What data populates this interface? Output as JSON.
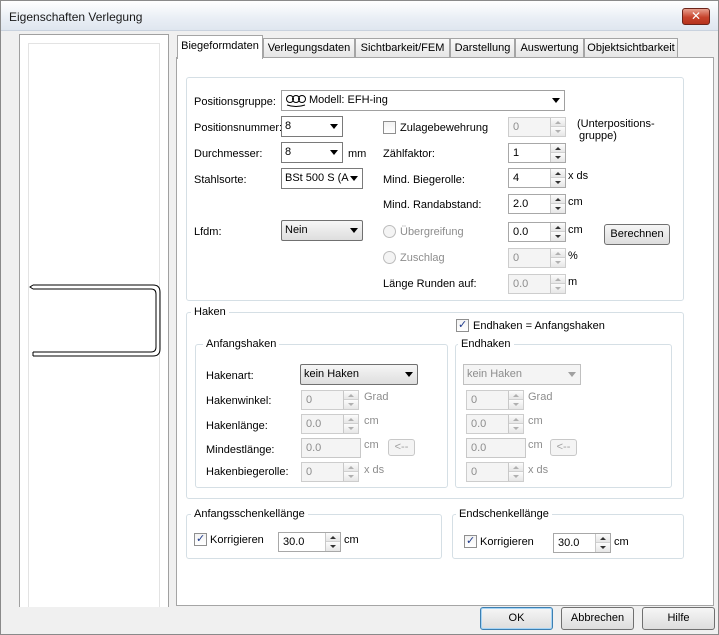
{
  "window": {
    "title": "Eigenschaften Verlegung",
    "close_glyph": "✕"
  },
  "tabs": [
    "Biegeformdaten",
    "Verlegungsdaten",
    "Sichtbarkeit/FEM",
    "Darstellung",
    "Auswertung",
    "Objektsichtbarkeit"
  ],
  "active_tab": "Biegeformdaten",
  "form": {
    "positionsgruppe_label": "Positionsgruppe:",
    "positionsgruppe_value": "Modell: EFH-ing",
    "positionsgruppe_icon": "model-group-icon",
    "positionsnummer_label": "Positionsnummer:",
    "positionsnummer_value": "8",
    "durchmesser_label": "Durchmesser:",
    "durchmesser_value": "8",
    "durchmesser_unit": "mm",
    "stahlsorte_label": "Stahlsorte:",
    "stahlsorte_value": "BSt 500 S (A",
    "lfdm_label": "Lfdm:",
    "lfdm_value": "Nein",
    "zulage_label": "Zulagebewehrung",
    "zulage_checked": false,
    "zulage_value": "0",
    "unterpos_note_line1": "(Unterpositions-",
    "unterpos_note_line2": "gruppe)",
    "zaehlfaktor_label": "Zählfaktor:",
    "zaehlfaktor_value": "1",
    "biegerolle_label": "Mind. Biegerolle:",
    "biegerolle_value": "4",
    "biegerolle_unit": "x ds",
    "randabstand_label": "Mind. Randabstand:",
    "randabstand_value": "2.0",
    "randabstand_unit": "cm",
    "uebergreifung_label": "Übergreifung",
    "uebergreifung_value": "0.0",
    "uebergreifung_unit": "cm",
    "berechnen_label": "Berechnen",
    "zuschlag_label": "Zuschlag",
    "zuschlag_value": "0",
    "zuschlag_unit": "%",
    "runden_label": "Länge Runden auf:",
    "runden_value": "0.0",
    "runden_unit": "m"
  },
  "haken": {
    "group_label": "Haken",
    "endhaken_equal_label": "Endhaken = Anfangshaken",
    "endhaken_equal_checked": true,
    "anfang": {
      "group_label": "Anfangshaken",
      "hakenart_label": "Hakenart:",
      "hakenart_value": "kein Haken",
      "hakenwinkel_label": "Hakenwinkel:",
      "hakenwinkel_value": "0",
      "hakenwinkel_unit": "Grad",
      "hakenlaenge_label": "Hakenlänge:",
      "hakenlaenge_value": "0.0",
      "hakenlaenge_unit": "cm",
      "mindestlaenge_label": "Mindestlänge:",
      "mindestlaenge_value": "0.0",
      "mindestlaenge_unit": "cm",
      "arrow_button": "<--",
      "biegerolle_label": "Hakenbiegerolle:",
      "biegerolle_value": "0",
      "biegerolle_unit": "x ds"
    },
    "end": {
      "group_label": "Endhaken",
      "hakenart_value": "kein Haken",
      "hakenwinkel_value": "0",
      "hakenwinkel_unit": "Grad",
      "hakenlaenge_value": "0.0",
      "hakenlaenge_unit": "cm",
      "mindestlaenge_value": "0.0",
      "mindestlaenge_unit": "cm",
      "arrow_button": "<--",
      "biegerolle_value": "0",
      "biegerolle_unit": "x ds"
    }
  },
  "anfangsschenkel": {
    "group_label": "Anfangsschenkellänge",
    "korrigieren_label": "Korrigieren",
    "korrigieren_checked": true,
    "value": "30.0",
    "unit": "cm"
  },
  "endschenkel": {
    "group_label": "Endschenkellänge",
    "korrigieren_label": "Korrigieren",
    "korrigieren_checked": true,
    "value": "30.0",
    "unit": "cm"
  },
  "buttons": {
    "ok": "OK",
    "cancel": "Abbrechen",
    "help": "Hilfe"
  }
}
